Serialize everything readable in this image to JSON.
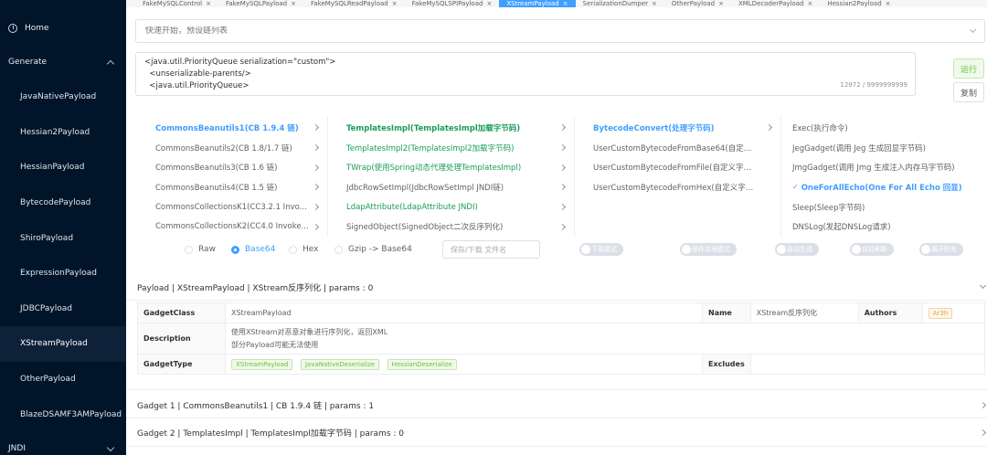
{
  "sidebar": {
    "home": "Home",
    "generate": "Generate",
    "items": [
      "JavaNativePayload",
      "Hessian2Payload",
      "HessianPayload",
      "BytecodePayload",
      "ShiroPayload",
      "ExpressionPayload",
      "JDBCPayload",
      "XStreamPayload",
      "OtherPayload",
      "BlazeDSAMF3AMPayload"
    ],
    "active": "XStreamPayload",
    "jndi": "JNDI"
  },
  "tabs": [
    {
      "label": "FakeMySQLControl",
      "active": false
    },
    {
      "label": "FakeMySQLPayload",
      "active": false
    },
    {
      "label": "FakeMySQLReadPayload",
      "active": false
    },
    {
      "label": "FakeMySQLSPIPayload",
      "active": false
    },
    {
      "label": "XStreamPayload",
      "active": true
    },
    {
      "label": "SerializationDumper",
      "active": false
    },
    {
      "label": "OtherPayload",
      "active": false
    },
    {
      "label": "XMLDecoderPayload",
      "active": false
    },
    {
      "label": "Hessian2Payload",
      "active": false
    }
  ],
  "search": {
    "placeholder": "快速开始，预设链列表"
  },
  "editor": {
    "lines": [
      "<java.util.PriorityQueue serialization=\"custom\">",
      "  <unserializable-parents/>",
      "  <java.util.PriorityQueue>"
    ],
    "count": "12972 / 9999999999"
  },
  "buttons": {
    "run": "运行",
    "copy": "复制"
  },
  "cascader": {
    "col1": [
      "CommonsBeanutils1(CB 1.9.4 链)",
      "CommonsBeanutils2(CB 1.8/1.7 链)",
      "CommonsBeanutils3(CB 1.6 链)",
      "CommonsBeanutils4(CB 1.5 链)",
      "CommonsCollectionsK1(CC3.2.1 Invo...",
      "CommonsCollectionsK2(CC4.0 Invoke..."
    ],
    "col2": [
      "TemplatesImpl(TemplatesImpl加载字节码)",
      "TemplatesImpl2(TemplatesImpl2加载字节码)",
      "TWrap(使用Spring动态代理处理TemplatesImpl)",
      "JdbcRowSetImpl(JdbcRowSetImpl JNDI链)",
      "LdapAttribute(LdapAttribute JNDI)",
      "SignedObject(SignedObject二次反序列化)"
    ],
    "col3": [
      "BytecodeConvert(处理字节码)",
      "UserCustomBytecodeFromBase64(自定义...",
      "UserCustomBytecodeFromFile(自定义字节...",
      "UserCustomBytecodeFromHex(自定义字节..."
    ],
    "col4": [
      "Exec(执行命令)",
      "JegGadget(调用 Jeg 生成回显字节码)",
      "JmgGadget(调用 Jmg 生成注入内存马字节码)",
      "OneForAllEcho(One For All Echo 回显)",
      "Sleep(Sleep字节码)",
      "DNSLog(发起DNSLog请求)"
    ]
  },
  "encoding": {
    "options": [
      "Raw",
      "Base64",
      "Hex",
      "Gzip -> Base64"
    ],
    "selected": "Base64",
    "save_placeholder": "保存/下载 文件名",
    "toggles": [
      "下载模式",
      "保存本地模式",
      "自动生成",
      "自动刷新",
      "展开所有"
    ]
  },
  "payload_panel": {
    "header": "Payload | XStreamPayload | XStream反序列化 | params : 0",
    "gadget_class_label": "GadgetClass",
    "gadget_class": "XStreamPayload",
    "name_label": "Name",
    "name": "XStream反序列化",
    "authors_label": "Authors",
    "author": "Ar3h",
    "description_label": "Description",
    "description_lines": [
      "使用XStream对恶意对象进行序列化，返回XML",
      "部分Payload可能无法使用"
    ],
    "gadget_type_label": "GadgetType",
    "gadget_types": [
      "XStreamPayload",
      "JavaNativeDeserialize",
      "HessianDeserialize"
    ],
    "excludes_label": "Excludes"
  },
  "gadget1": "Gadget 1 | CommonsBeanutils1 | CB 1.9.4 链 | params : 1",
  "gadget2": "Gadget 2 | TemplatesImpl | TemplatesImpl加载字节码 | params : 0"
}
